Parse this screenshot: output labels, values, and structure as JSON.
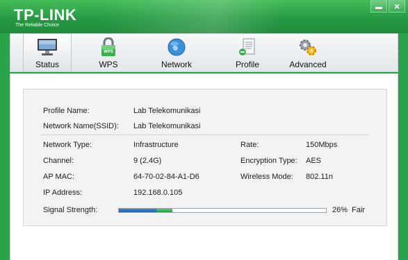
{
  "app": {
    "logo_text": "TP-LINK",
    "logo_tagline": "The Reliable Choice",
    "minimize_symbol": "–",
    "close_symbol": "×",
    "brand_color": "#2aa34a"
  },
  "tabs": [
    {
      "label": "Status",
      "icon": "monitor-icon",
      "active": true
    },
    {
      "label": "WPS",
      "icon": "wps-lock-icon",
      "active": false
    },
    {
      "label": "Network",
      "icon": "globe-icon",
      "active": false
    },
    {
      "label": "Profile",
      "icon": "profile-document-icon",
      "active": false
    },
    {
      "label": "Advanced",
      "icon": "gears-icon",
      "active": false
    }
  ],
  "status": {
    "profile_name_label": "Profile Name:",
    "profile_name_value": "Lab Telekomunikasi",
    "ssid_label": "Network Name(SSID):",
    "ssid_value": "Lab Telekomunikasi",
    "network_type_label": "Network Type:",
    "network_type_value": "Infrastructure",
    "rate_label": "Rate:",
    "rate_value": "150Mbps",
    "channel_label": "Channel:",
    "channel_value": "9 (2.4G)",
    "encryption_label": "Encryption Type:",
    "encryption_value": "AES",
    "ap_mac_label": "AP MAC:",
    "ap_mac_value": "64-70-02-84-A1-D6",
    "wireless_mode_label": "Wireless Mode:",
    "wireless_mode_value": "802.11n",
    "ip_label": "IP Address:",
    "ip_value": "192.168.0.105",
    "signal_label": "Signal Strength:",
    "signal_percent": 26,
    "signal_percent_text": "26%",
    "signal_quality": "Fair"
  }
}
